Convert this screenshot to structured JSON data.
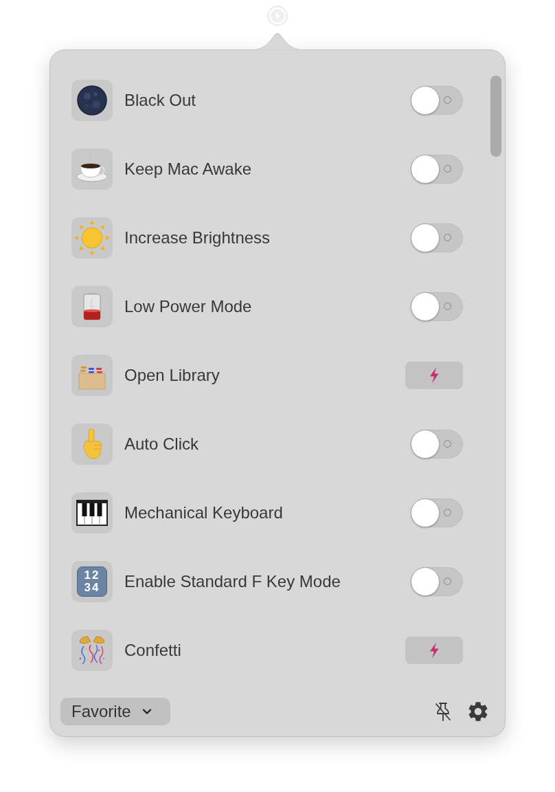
{
  "items": [
    {
      "label": "Black Out",
      "kind": "toggle",
      "on": false
    },
    {
      "label": "Keep Mac Awake",
      "kind": "toggle",
      "on": false
    },
    {
      "label": "Increase Brightness",
      "kind": "toggle",
      "on": false
    },
    {
      "label": "Low Power Mode",
      "kind": "toggle",
      "on": false
    },
    {
      "label": "Open Library",
      "kind": "action"
    },
    {
      "label": "Auto Click",
      "kind": "toggle",
      "on": false
    },
    {
      "label": "Mechanical Keyboard",
      "kind": "toggle",
      "on": false
    },
    {
      "label": "Enable Standard F Key Mode",
      "kind": "toggle",
      "on": false,
      "keycap": [
        "12",
        "34"
      ]
    },
    {
      "label": "Confetti",
      "kind": "action"
    }
  ],
  "footer": {
    "dropdown": {
      "label": "Favorite"
    }
  }
}
